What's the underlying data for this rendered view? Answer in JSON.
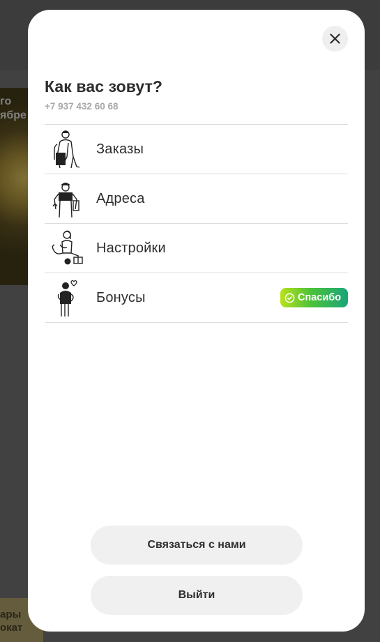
{
  "background": {
    "banner_text": "го\nябре",
    "bottom_card_text": "ары\nокат"
  },
  "modal": {
    "close_icon": "close-icon",
    "profile": {
      "name": "Как вас зовут?",
      "phone": "+7 937 432 60 68"
    },
    "menu": [
      {
        "label": "Заказы",
        "icon": "courier-with-bag-icon"
      },
      {
        "label": "Адреса",
        "icon": "courier-with-helmet-icon"
      },
      {
        "label": "Настройки",
        "icon": "person-with-tools-icon"
      },
      {
        "label": "Бонусы",
        "icon": "person-hugging-icon",
        "badge": "Спасибо"
      }
    ],
    "contact_button": "Связаться с нами",
    "logout_button": "Выйти"
  },
  "colors": {
    "text": "#2d2d2d",
    "muted": "#a8a8a8",
    "button_bg": "#f0f0f0",
    "badge_gradient": [
      "#b8e21b",
      "#4cc23a",
      "#1aa57a"
    ]
  }
}
